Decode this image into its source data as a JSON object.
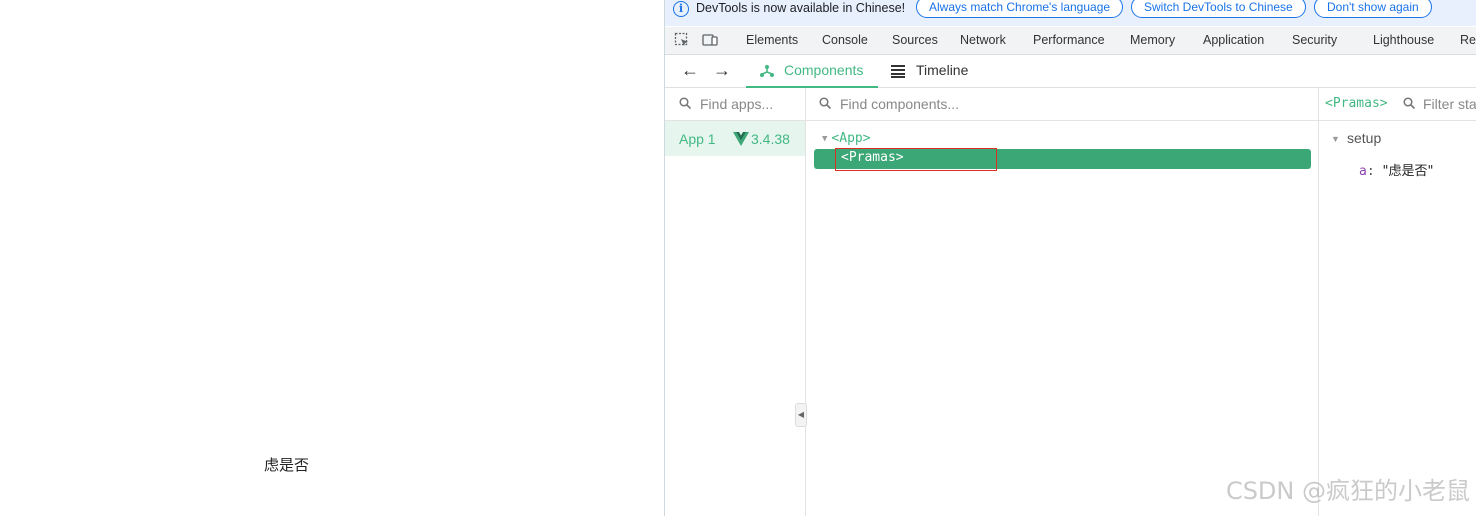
{
  "page": {
    "rendered_text": "虑是否"
  },
  "infobar": {
    "message": "DevTools is now available in Chinese!",
    "buttons": [
      "Always match Chrome's language",
      "Switch DevTools to Chinese",
      "Don't show again"
    ]
  },
  "devtools_tabs": [
    "Elements",
    "Console",
    "Sources",
    "Network",
    "Performance",
    "Memory",
    "Application",
    "Security",
    "Lighthouse",
    "Rec"
  ],
  "vue_toolbar": {
    "tabs": [
      "Components",
      "Timeline"
    ],
    "active": "Components"
  },
  "apps_pane": {
    "search_placeholder": "Find apps...",
    "apps": [
      {
        "name": "App 1",
        "version": "3.4.38"
      }
    ]
  },
  "tree_pane": {
    "search_placeholder": "Find components...",
    "nodes": [
      {
        "label": "<App>"
      },
      {
        "label": "<Pramas>",
        "selected": true
      }
    ]
  },
  "state_pane": {
    "selected_component": "<Pramas>",
    "filter_placeholder": "Filter state...",
    "section": "setup",
    "props": [
      {
        "key": "a",
        "value": "\"虑是否\""
      }
    ]
  },
  "watermark": "CSDN @疯狂的小老鼠",
  "colors": {
    "vue_green": "#42b883",
    "selection": "#3ba776",
    "highlight_box": "#d93025",
    "infobar_bg": "#e8f0fe",
    "link_blue": "#1a73e8"
  }
}
